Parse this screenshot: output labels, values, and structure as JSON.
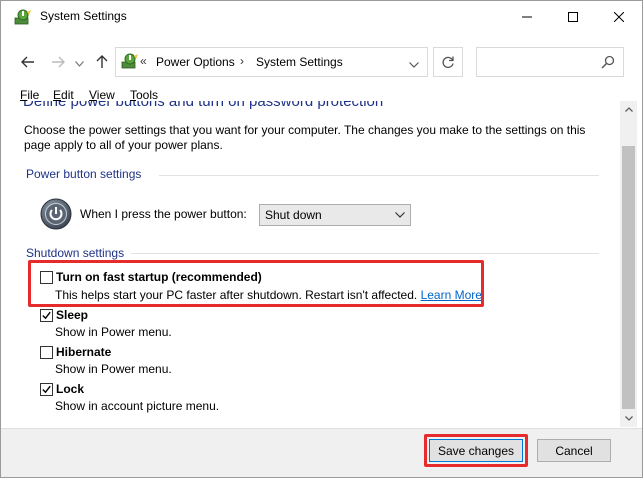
{
  "window": {
    "title": "System Settings"
  },
  "address_bar": {
    "prefix": "«",
    "crumbs": [
      "Power Options",
      "System Settings"
    ],
    "separator": "›"
  },
  "search": {
    "placeholder": ""
  },
  "menu": {
    "items": [
      {
        "label": "File",
        "mnemonic": "F",
        "rest": "ile"
      },
      {
        "label": "Edit",
        "mnemonic": "E",
        "rest": "dit"
      },
      {
        "label": "View",
        "mnemonic": "V",
        "rest": "iew"
      },
      {
        "label": "Tools",
        "mnemonic": "T",
        "rest": "ools"
      }
    ]
  },
  "page": {
    "heading": "Define power buttons and turn on password protection",
    "intro": "Choose the power settings that you want for your computer. The changes you make to the settings on this page apply to all of your power plans."
  },
  "power_button": {
    "group_label": "Power button settings",
    "label": "When I press the power button:",
    "selected": "Shut down"
  },
  "shutdown": {
    "group_label": "Shutdown settings",
    "options": [
      {
        "label": "Turn on fast startup (recommended)",
        "desc": "This helps start your PC faster after shutdown. Restart isn't affected.",
        "link": "Learn More",
        "checked": false
      },
      {
        "label": "Sleep",
        "desc": "Show in Power menu.",
        "checked": true
      },
      {
        "label": "Hibernate",
        "desc": "Show in Power menu.",
        "checked": false
      },
      {
        "label": "Lock",
        "desc": "Show in account picture menu.",
        "checked": true
      }
    ]
  },
  "footer": {
    "save_label": "Save changes",
    "cancel_label": "Cancel"
  },
  "colors": {
    "heading": "#1e3287",
    "link": "#0066cc",
    "highlight": "#e52b2b"
  }
}
